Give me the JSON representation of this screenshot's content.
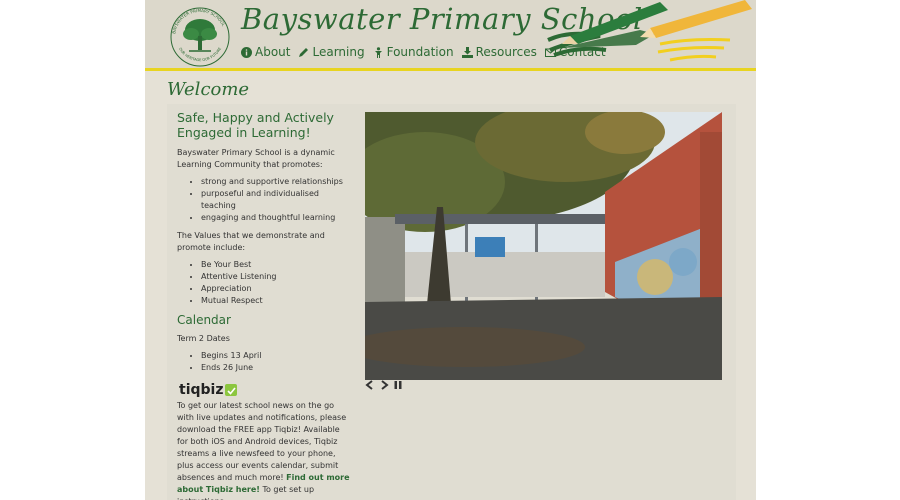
{
  "header": {
    "site_title": "Bayswater Primary School",
    "logo_ring_text_top": "BAYSWATER PRIMARY SCHOOL",
    "logo_ring_text_bottom": "OUR HERITAGE OUR FUTURE",
    "nav": [
      {
        "label": "About",
        "icon": "info-icon"
      },
      {
        "label": "Learning",
        "icon": "pencil-icon"
      },
      {
        "label": "Foundation",
        "icon": "child-icon"
      },
      {
        "label": "Resources",
        "icon": "download-icon"
      },
      {
        "label": "Contact",
        "icon": "envelope-icon"
      }
    ]
  },
  "welcome": "Welcome",
  "intro": {
    "headline": "Safe, Happy and Actively Engaged in Learning!",
    "paragraph": "Bayswater Primary School is a dynamic Learning Community that promotes:",
    "promotes": [
      "strong and supportive relationships",
      "purposeful and individualised teaching",
      "engaging and thoughtful learning"
    ],
    "values_intro": "The Values that we demonstrate and promote include:",
    "values": [
      "Be Your Best",
      "Attentive Listening",
      "Appreciation",
      "Mutual Respect"
    ]
  },
  "calendar": {
    "title": "Calendar",
    "subtitle": "Term 2 Dates",
    "dates": [
      "Begins 13 April",
      "Ends 26 June"
    ]
  },
  "tiqbiz": {
    "logo_text": "tiqbiz",
    "text_before_link": "To get our latest school news on the go with live updates and notifications, please download the FREE app Tiqbiz! Available for both iOS and Android devices, Tiqbiz streams a live newsfeed to your phone, plus access our events calendar, submit absences and much more!",
    "link": "Find out more about Tiqbiz here!",
    "text_after_link": "To get set up instructions"
  },
  "colors": {
    "brand_green": "#2d6a35",
    "header_line_yellow": "#e8d421",
    "page_bg": "#e5e1d6"
  }
}
